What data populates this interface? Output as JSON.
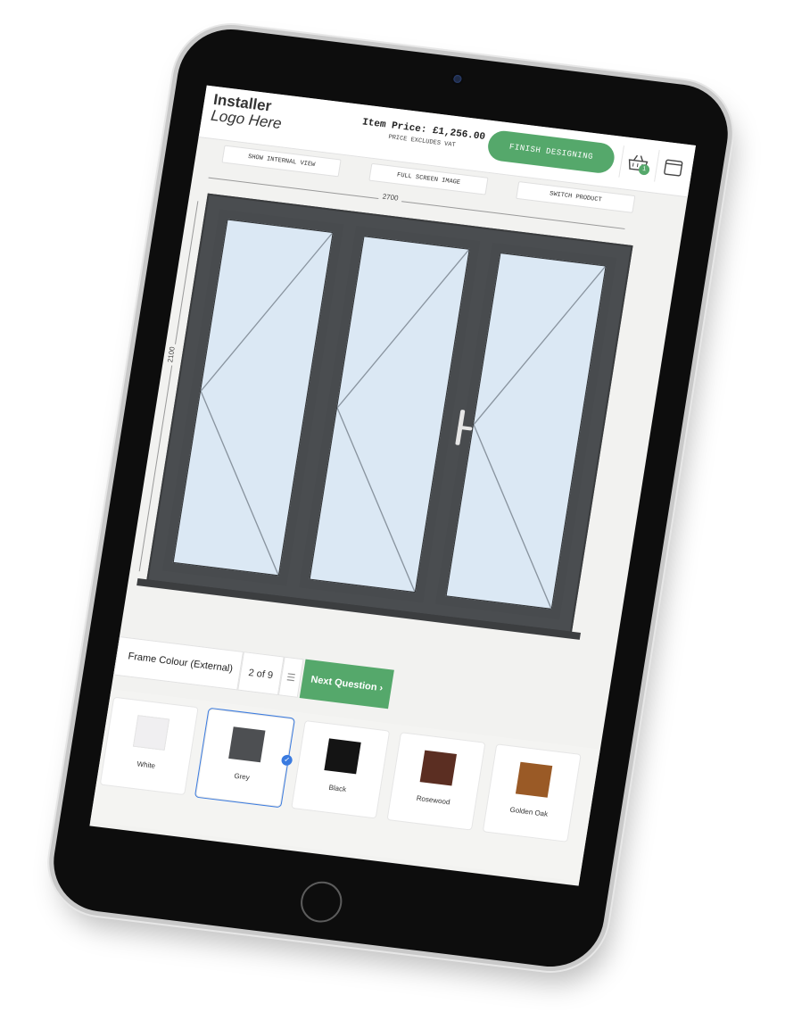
{
  "header": {
    "logo_line1": "Installer",
    "logo_line2": "Logo Here",
    "item_price": "Item Price: £1,256.00",
    "vat_note": "PRICE EXCLUDES VAT",
    "finish_label": "FINISH DESIGNING",
    "basket_count": "1",
    "basket_icon": "basket-icon",
    "window_icon": "window-icon"
  },
  "toolbar": {
    "internal_view_label": "SHOW INTERNAL VIEW",
    "full_screen_label": "FULL SCREEN IMAGE",
    "switch_product_label": "SWITCH PRODUCT"
  },
  "drawing": {
    "width_label": "2700",
    "height_label": "2100",
    "frame_color": "#4a4d50",
    "glass_color": "#dbe8f4"
  },
  "question": {
    "label": "Frame Colour (External)",
    "step": "2 of 9",
    "list_icon": "list-icon",
    "next_label": "Next Question",
    "next_icon": "chevron-right-icon"
  },
  "swatches": [
    {
      "label": "White",
      "color": "#f0eff1",
      "selected": false
    },
    {
      "label": "Grey",
      "color": "#4d4f52",
      "selected": true
    },
    {
      "label": "Black",
      "color": "#141414",
      "selected": false
    },
    {
      "label": "Rosewood",
      "color": "#5b2e22",
      "selected": false
    },
    {
      "label": "Golden Oak",
      "color": "#9a5a26",
      "selected": false
    }
  ],
  "colors": {
    "accent_green": "#55a86b",
    "selected_blue": "#3a7be0"
  }
}
